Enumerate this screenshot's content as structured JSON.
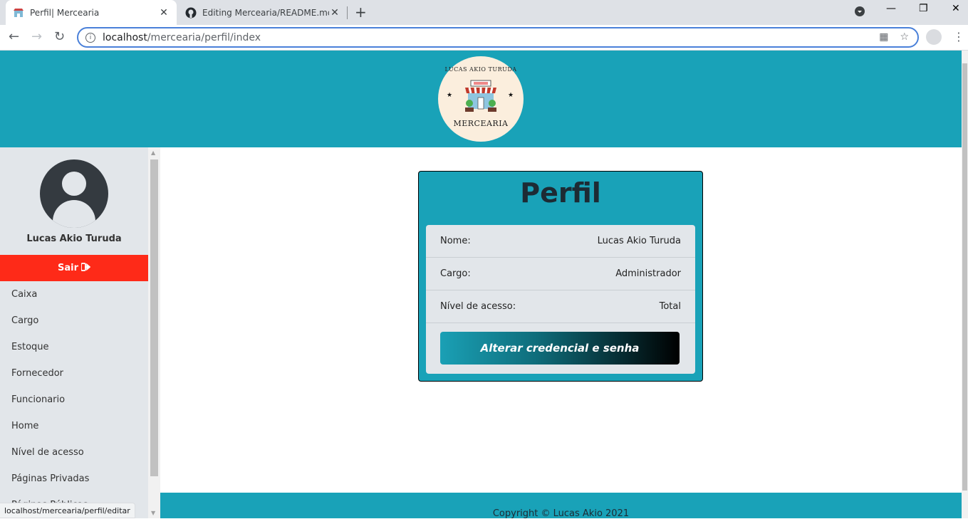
{
  "browser": {
    "tabs": [
      {
        "title": "Perfil| Mercearia",
        "close": "✕"
      },
      {
        "title": "Editing Mercearia/README.md a",
        "close": "✕"
      }
    ],
    "new_tab": "+",
    "url_host": "localhost",
    "url_path": "/mercearia/perfil/index",
    "window_controls": [
      "—",
      "❐",
      "✕"
    ],
    "status_url": "localhost/mercearia/perfil/editar"
  },
  "logo": {
    "top_text": "LUCAS AKIO TURUDA",
    "bottom_text": "MERCEARIA"
  },
  "sidebar": {
    "user_name": "Lucas Akio Turuda",
    "logout_label": "Sair",
    "items": [
      "Caixa",
      "Cargo",
      "Estoque",
      "Fornecedor",
      "Funcionario",
      "Home",
      "Nível de acesso",
      "Páginas Privadas",
      "Páginas Públicas"
    ]
  },
  "profile": {
    "title": "Perfil",
    "rows": [
      {
        "label": "Nome:",
        "value": "Lucas Akio Turuda"
      },
      {
        "label": "Cargo:",
        "value": "Administrador"
      },
      {
        "label": "Nível de acesso:",
        "value": "Total"
      }
    ],
    "button_label": "Alterar credencial e senha"
  },
  "footer": {
    "text": "Copyright © Lucas Akio 2021"
  },
  "colors": {
    "primary": "#19a2b8",
    "sidebar_bg": "#e2e6ea",
    "logout": "#fe2a18",
    "title_text": "#1d2b34"
  }
}
